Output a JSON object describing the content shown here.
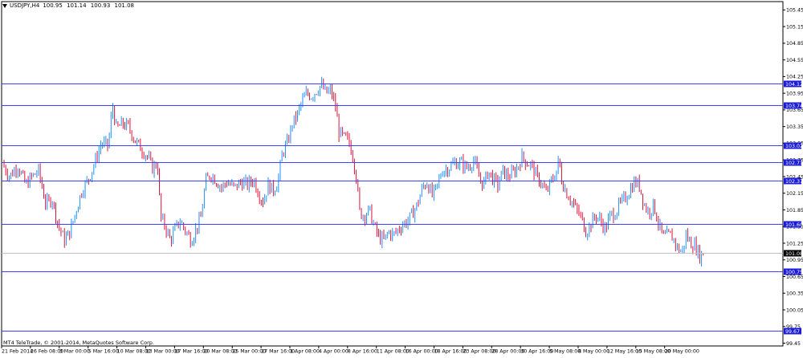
{
  "header": {
    "symbol": "USDJPY,H4",
    "open": "100.95",
    "high": "101.14",
    "low": "100.93",
    "close": "101.08"
  },
  "footer": {
    "copyright": "MT4 TeleTrade, © 2001-2014, MetaQuotes Software Corp."
  },
  "colors": {
    "bull": "#1e90ff",
    "bear": "#dc143c",
    "level_line": "#4040ff",
    "level_tag": "#1c1cd8",
    "current_line": "#c0c0c0",
    "current_tag": "#000000",
    "frame": "#000000"
  },
  "chart_data": {
    "type": "candlestick",
    "ylim": [
      99.4,
      105.6
    ],
    "y_ticks": [
      "105.45",
      "105.15",
      "104.85",
      "104.55",
      "104.25",
      "103.95",
      "103.65",
      "103.35",
      "103.05",
      "102.75",
      "102.45",
      "102.15",
      "101.85",
      "101.55",
      "101.25",
      "100.95",
      "100.65",
      "100.35",
      "100.05",
      "99.75",
      "99.45"
    ],
    "x_ticks": [
      "21 Feb 2014",
      "26 Feb 08:00",
      "3 Mar 00:00",
      "5 Mar 16:00",
      "10 Mar 08:00",
      "13 Mar 00:00",
      "17 Mar 16:00",
      "20 Mar 08:00",
      "25 Mar 00:00",
      "27 Mar 16:00",
      "1 Apr 08:00",
      "4 Apr 00:00",
      "8 Apr 16:00",
      "11 Apr 08:00",
      "16 Apr 00:00",
      "18 Apr 16:00",
      "23 Apr 08:00",
      "28 Apr 00:00",
      "30 Apr 16:00",
      "5 May 08:00",
      "8 May 00:00",
      "12 May 16:00",
      "15 May 08:00",
      "20 May 00:00"
    ],
    "levels": [
      {
        "value": 104.12,
        "label": "104.12"
      },
      {
        "value": 103.74,
        "label": "103.74"
      },
      {
        "value": 103.02,
        "label": "103.02"
      },
      {
        "value": 102.71,
        "label": "102.71"
      },
      {
        "value": 102.37,
        "label": "102.37"
      },
      {
        "value": 101.6,
        "label": "101.60"
      },
      {
        "value": 100.75,
        "label": "100.75"
      },
      {
        "value": 99.67,
        "label": "99.67"
      }
    ],
    "current_price": {
      "value": 101.08,
      "label": "101.08"
    },
    "price_path": [
      [
        0,
        102.7
      ],
      [
        10,
        102.45
      ],
      [
        20,
        102.65
      ],
      [
        30,
        102.3
      ],
      [
        38,
        102.45
      ],
      [
        46,
        102.55
      ],
      [
        55,
        101.95
      ],
      [
        63,
        102.05
      ],
      [
        70,
        101.6
      ],
      [
        78,
        101.3
      ],
      [
        85,
        101.45
      ],
      [
        92,
        101.8
      ],
      [
        100,
        102.2
      ],
      [
        108,
        102.4
      ],
      [
        116,
        102.7
      ],
      [
        124,
        103.05
      ],
      [
        133,
        103.0
      ],
      [
        138,
        103.75
      ],
      [
        143,
        103.3
      ],
      [
        150,
        103.4
      ],
      [
        158,
        103.35
      ],
      [
        166,
        103.1
      ],
      [
        174,
        102.95
      ],
      [
        182,
        102.8
      ],
      [
        188,
        102.6
      ],
      [
        194,
        102.7
      ],
      [
        198,
        101.7
      ],
      [
        204,
        101.55
      ],
      [
        210,
        101.3
      ],
      [
        216,
        101.5
      ],
      [
        222,
        101.65
      ],
      [
        230,
        101.45
      ],
      [
        236,
        101.3
      ],
      [
        242,
        101.5
      ],
      [
        248,
        101.7
      ],
      [
        254,
        102.35
      ],
      [
        260,
        102.5
      ],
      [
        266,
        102.4
      ],
      [
        274,
        102.25
      ],
      [
        280,
        102.35
      ],
      [
        290,
        102.25
      ],
      [
        298,
        102.35
      ],
      [
        306,
        102.3
      ],
      [
        314,
        102.4
      ],
      [
        320,
        102.15
      ],
      [
        326,
        102.0
      ],
      [
        332,
        102.3
      ],
      [
        338,
        102.2
      ],
      [
        344,
        102.35
      ],
      [
        350,
        102.9
      ],
      [
        356,
        103.05
      ],
      [
        362,
        103.4
      ],
      [
        368,
        103.55
      ],
      [
        374,
        103.8
      ],
      [
        380,
        103.95
      ],
      [
        386,
        103.9
      ],
      [
        392,
        104.0
      ],
      [
        398,
        104.1
      ],
      [
        404,
        103.95
      ],
      [
        410,
        104.0
      ],
      [
        416,
        103.7
      ],
      [
        420,
        103.25
      ],
      [
        426,
        103.15
      ],
      [
        432,
        103.1
      ],
      [
        438,
        102.8
      ],
      [
        442,
        102.4
      ],
      [
        446,
        101.8
      ],
      [
        452,
        101.75
      ],
      [
        458,
        101.85
      ],
      [
        464,
        101.55
      ],
      [
        470,
        101.35
      ],
      [
        476,
        101.3
      ],
      [
        482,
        101.45
      ],
      [
        488,
        101.4
      ],
      [
        494,
        101.5
      ],
      [
        500,
        101.6
      ],
      [
        506,
        101.65
      ],
      [
        512,
        101.8
      ],
      [
        518,
        101.95
      ],
      [
        524,
        102.25
      ],
      [
        530,
        102.35
      ],
      [
        536,
        102.1
      ],
      [
        542,
        102.25
      ],
      [
        548,
        102.55
      ],
      [
        556,
        102.6
      ],
      [
        564,
        102.7
      ],
      [
        572,
        102.7
      ],
      [
        580,
        102.6
      ],
      [
        588,
        102.75
      ],
      [
        594,
        102.45
      ],
      [
        600,
        102.3
      ],
      [
        606,
        102.55
      ],
      [
        612,
        102.4
      ],
      [
        618,
        102.3
      ],
      [
        624,
        102.55
      ],
      [
        630,
        102.45
      ],
      [
        636,
        102.5
      ],
      [
        642,
        102.6
      ],
      [
        648,
        102.8
      ],
      [
        654,
        102.7
      ],
      [
        660,
        102.65
      ],
      [
        666,
        102.45
      ],
      [
        672,
        102.35
      ],
      [
        678,
        102.15
      ],
      [
        684,
        102.35
      ],
      [
        690,
        102.5
      ],
      [
        694,
        102.75
      ],
      [
        698,
        102.35
      ],
      [
        704,
        102.15
      ],
      [
        710,
        102.0
      ],
      [
        716,
        101.85
      ],
      [
        722,
        101.7
      ],
      [
        728,
        101.45
      ],
      [
        734,
        101.6
      ],
      [
        740,
        101.75
      ],
      [
        746,
        101.65
      ],
      [
        752,
        101.5
      ],
      [
        758,
        101.75
      ],
      [
        764,
        101.8
      ],
      [
        770,
        101.95
      ],
      [
        776,
        102.05
      ],
      [
        782,
        102.2
      ],
      [
        788,
        102.35
      ],
      [
        794,
        102.3
      ],
      [
        800,
        101.95
      ],
      [
        806,
        101.8
      ],
      [
        812,
        101.95
      ],
      [
        818,
        101.6
      ],
      [
        824,
        101.35
      ],
      [
        830,
        101.4
      ],
      [
        836,
        101.35
      ],
      [
        842,
        101.15
      ],
      [
        848,
        101.1
      ],
      [
        852,
        101.4
      ],
      [
        858,
        101.25
      ],
      [
        864,
        101.2
      ],
      [
        870,
        101.0
      ],
      [
        874,
        101.08
      ]
    ]
  }
}
